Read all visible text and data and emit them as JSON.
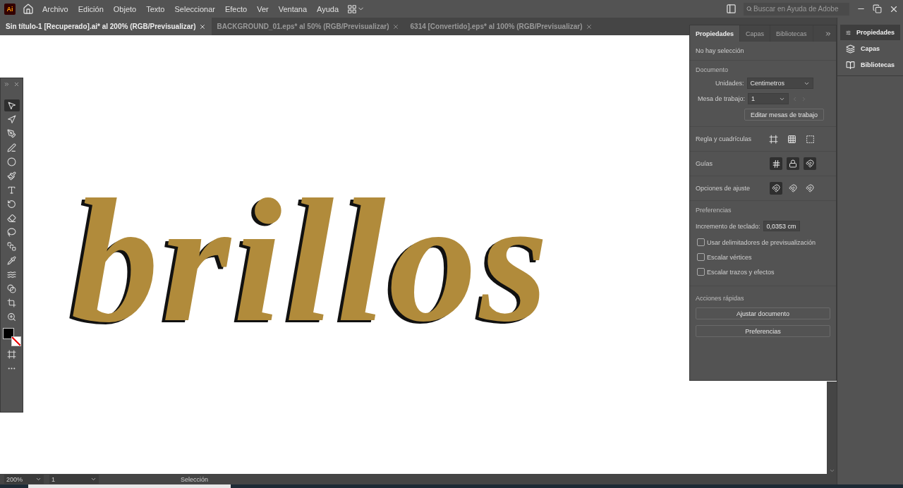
{
  "menu": [
    "Archivo",
    "Edición",
    "Objeto",
    "Texto",
    "Seleccionar",
    "Efecto",
    "Ver",
    "Ventana",
    "Ayuda"
  ],
  "app_badge": "Ai",
  "search": {
    "placeholder": "Buscar en Ayuda de Adobe"
  },
  "doc_tabs": [
    {
      "label": "Sin título-1 [Recuperado].ai* al 200% (RGB/Previsualizar)",
      "selected": true
    },
    {
      "label": "BACKGROUND_01.eps* al 50% (RGB/Previsualizar)",
      "selected": false
    },
    {
      "label": "6314 [Convertido].eps* al 100% (RGB/Previsualizar)",
      "selected": false
    }
  ],
  "tools": [
    {
      "kind": "selection",
      "selected": true
    },
    {
      "kind": "direct",
      "selected": false
    },
    {
      "kind": "pen",
      "selected": false
    },
    {
      "kind": "curvature",
      "selected": false
    },
    {
      "kind": "ellipse",
      "selected": false
    },
    {
      "kind": "brush",
      "selected": false
    },
    {
      "kind": "type",
      "selected": false
    },
    {
      "kind": "rotate",
      "selected": false
    },
    {
      "kind": "eraser",
      "selected": false
    },
    {
      "kind": "lasso",
      "selected": false
    },
    {
      "kind": "gradient",
      "selected": false
    },
    {
      "kind": "eyedropper",
      "selected": false
    },
    {
      "kind": "warp",
      "selected": false
    },
    {
      "kind": "blend",
      "selected": false
    },
    {
      "kind": "artboard",
      "selected": false
    },
    {
      "kind": "zoom",
      "selected": false
    }
  ],
  "canvas": {
    "artwork_text": "brillos"
  },
  "properties_panel": {
    "tabs": [
      {
        "label": "Propiedades",
        "selected": true
      },
      {
        "label": "Capas",
        "selected": false
      },
      {
        "label": "Bibliotecas",
        "selected": false
      }
    ],
    "selection_status": "No hay selección",
    "document": {
      "heading": "Documento",
      "units_label": "Unidades:",
      "units_value": "Centimetros",
      "artboard_label": "Mesa de trabajo:",
      "artboard_value": "1",
      "edit_button": "Editar mesas de trabajo"
    },
    "rulers_label": "Regla y cuadrículas",
    "guides_label": "Guías",
    "snap_label": "Opciones de ajuste",
    "snap_options": [
      {
        "selected": true
      },
      {
        "selected": false
      },
      {
        "selected": false
      }
    ],
    "preferences": {
      "heading": "Preferencias",
      "keyboard_label": "Incremento de teclado:",
      "keyboard_value": "0,0353 cm",
      "options": [
        {
          "label": "Usar delimitadores de previsualización",
          "checked": false
        },
        {
          "label": "Escalar vértices",
          "checked": false
        },
        {
          "label": "Escalar trazos y efectos",
          "checked": false
        }
      ]
    },
    "quick_actions": {
      "heading": "Acciones rápidas",
      "buttons": [
        "Ajustar documento",
        "Preferencias"
      ]
    }
  },
  "dock": [
    {
      "kind": "properties",
      "label": "Propiedades",
      "selected": true
    },
    {
      "kind": "layers",
      "label": "Capas",
      "selected": false
    },
    {
      "kind": "libraries",
      "label": "Bibliotecas",
      "selected": false
    }
  ],
  "status_bar": {
    "zoom": "200%",
    "artboard": "1",
    "tool": "Selección"
  }
}
